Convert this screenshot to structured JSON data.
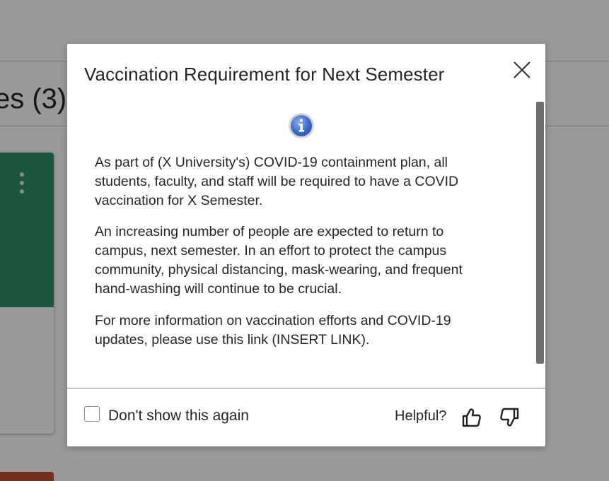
{
  "background": {
    "section_title": "es (3)"
  },
  "modal": {
    "title": "Vaccination Requirement for Next Semester",
    "close_icon": "close-icon",
    "info_icon": "info-icon",
    "paragraphs": [
      "As part of (X University's) COVID-19 containment plan, all students, faculty, and staff will be required to have a COVID vaccination for X Semester.",
      "An increasing number of people are expected to return to campus, next semester. In an effort to protect the campus community, physical distancing, mask-wearing, and frequent hand-washing will continue to be crucial.",
      "For more information on vaccination efforts and COVID-19 updates, please use this link (INSERT LINK)."
    ],
    "footer": {
      "checkbox_label": "Don't show this again",
      "checkbox_checked": false,
      "helpful_label": "Helpful?",
      "thumbs_up_icon": "thumbs-up-icon",
      "thumbs_down_icon": "thumbs-down-icon"
    }
  },
  "colors": {
    "card_banner": "#2f8f6a",
    "info_icon_fill": "#3f6fd0",
    "text": "#262626",
    "overlay": "rgba(0,0,0,0.4)"
  }
}
